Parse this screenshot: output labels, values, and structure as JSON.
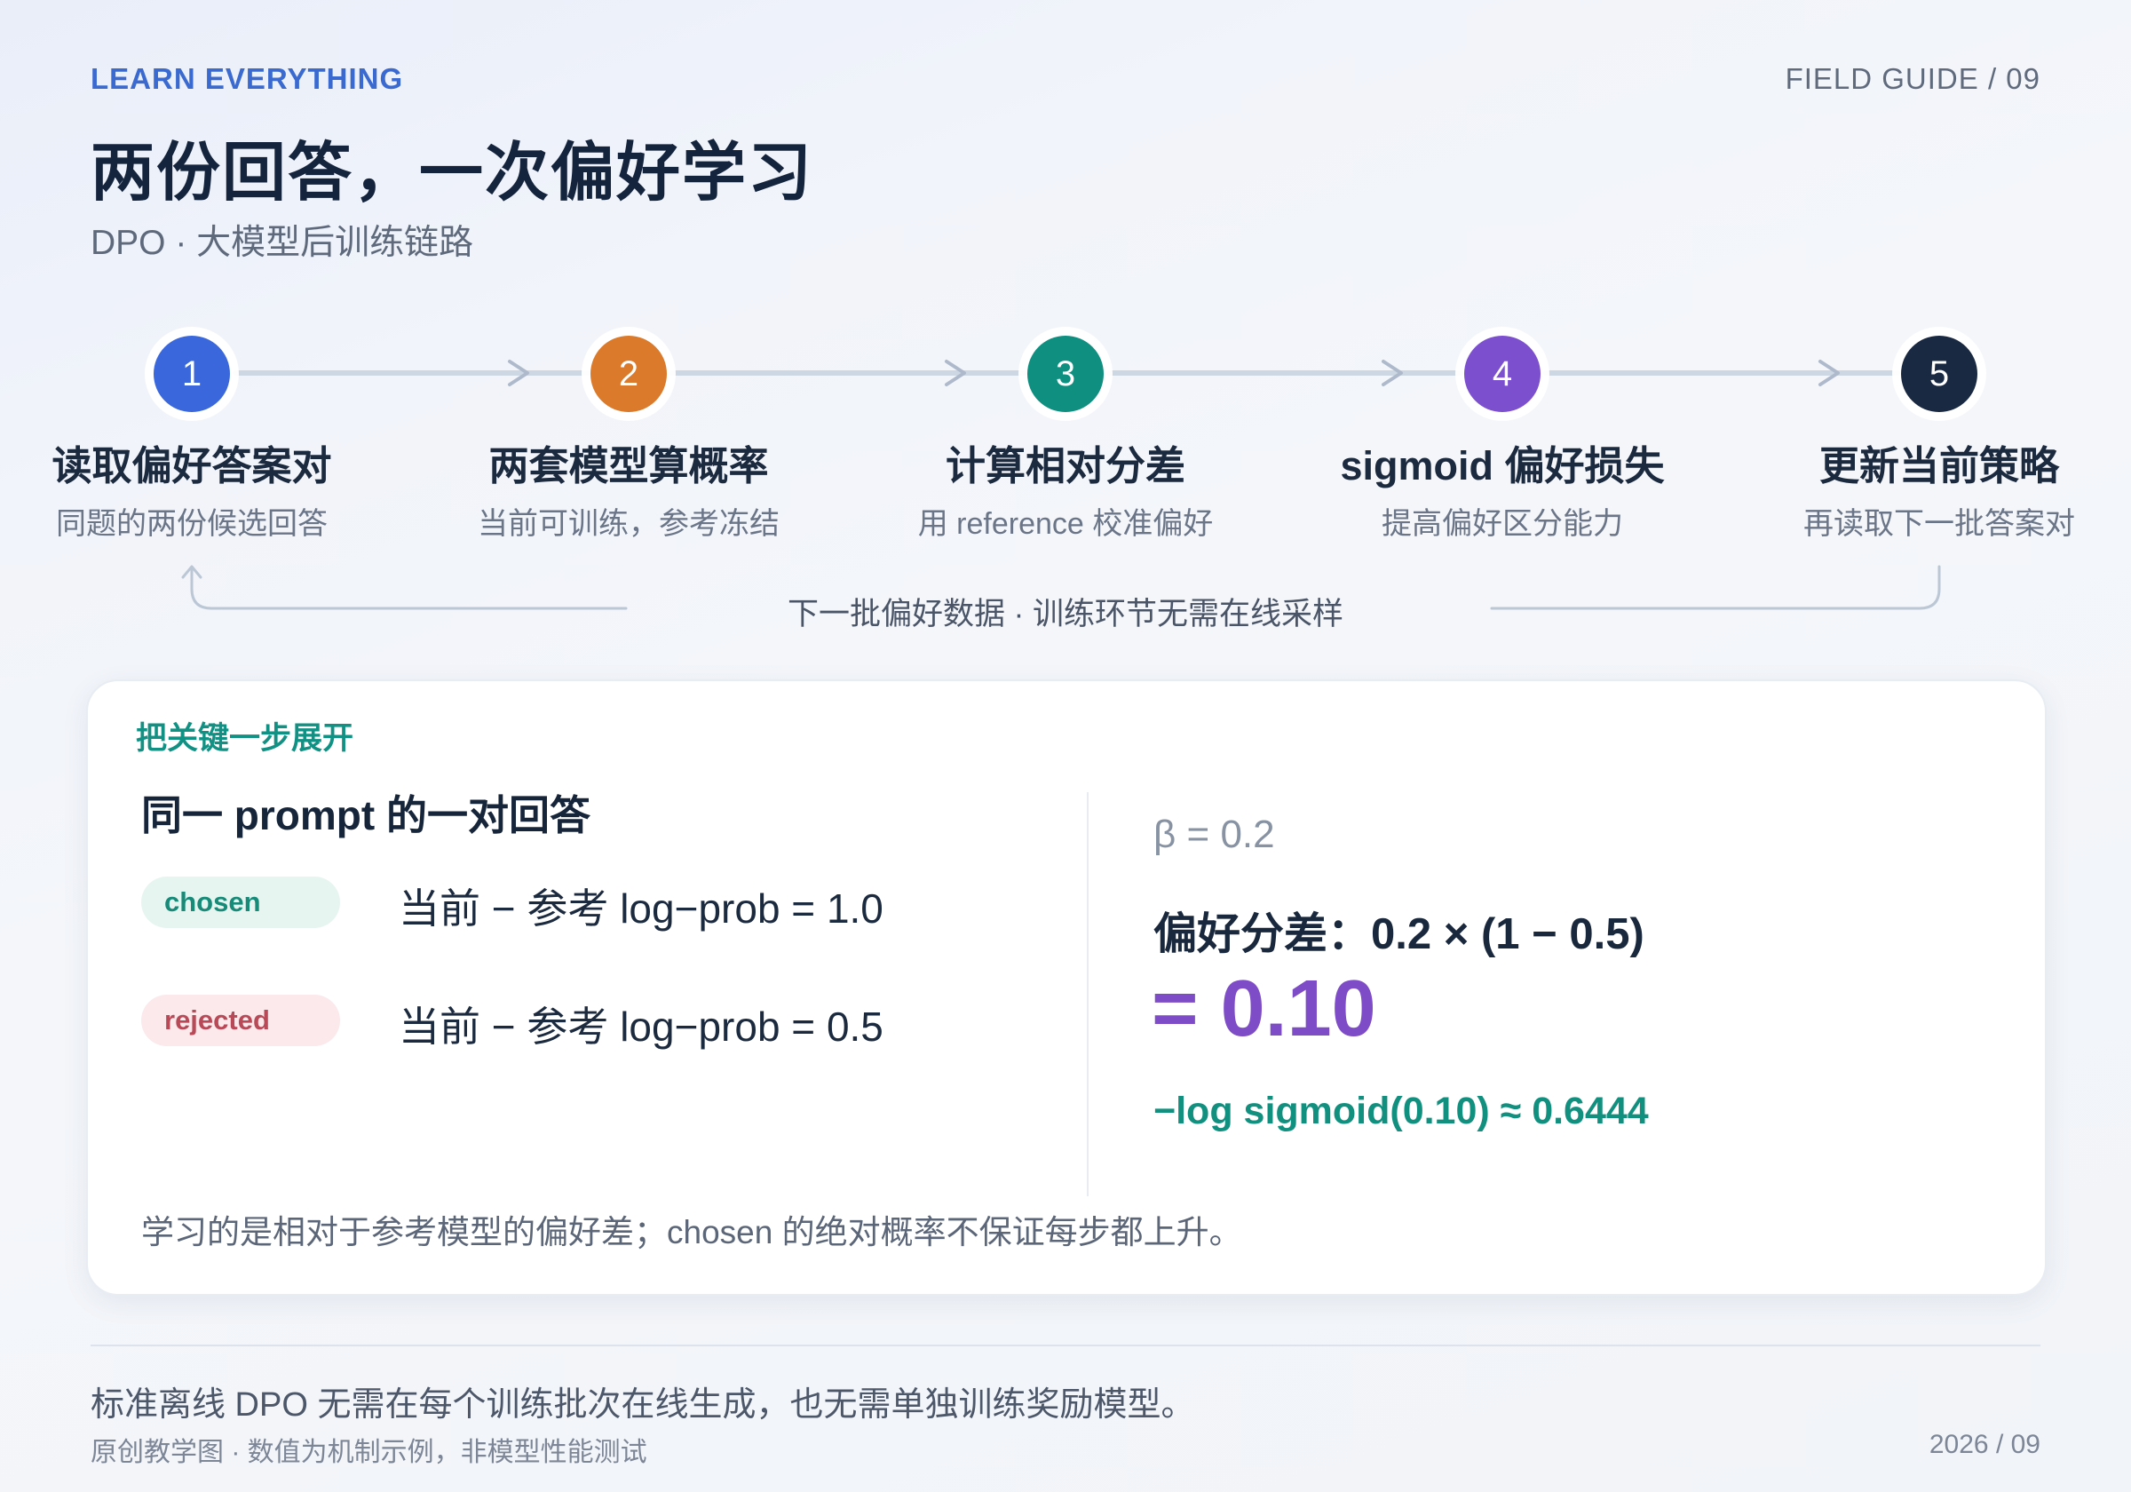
{
  "header": {
    "eyebrow": "LEARN EVERYTHING",
    "guide": "FIELD GUIDE / 09",
    "title": "两份回答，一次偏好学习",
    "subtitle": "DPO · 大模型后训练链路"
  },
  "steps": [
    {
      "num": "1",
      "title": "读取偏好答案对",
      "sub": "同题的两份候选回答",
      "color": "#3a68dc"
    },
    {
      "num": "2",
      "title": "两套模型算概率",
      "sub": "当前可训练，参考冻结",
      "color": "#dc7a2b"
    },
    {
      "num": "3",
      "title": "计算相对分差",
      "sub": "用 reference 校准偏好",
      "color": "#0f8f80"
    },
    {
      "num": "4",
      "title": "sigmoid 偏好损失",
      "sub": "提高偏好区分能力",
      "color": "#7c4fcf"
    },
    {
      "num": "5",
      "title": "更新当前策略",
      "sub": "再读取下一批答案对",
      "color": "#1a2942"
    }
  ],
  "loop_caption": "下一批偏好数据 · 训练环节无需在线采样",
  "card": {
    "eyebrow": "把关键一步展开",
    "heading": "同一 prompt 的一对回答",
    "chosen_label": "chosen",
    "chosen_eq": "当前 − 参考 log−prob = 1.0",
    "rejected_label": "rejected",
    "rejected_eq": "当前 − 参考 log−prob = 0.5",
    "beta": "β = 0.2",
    "diff": "偏好分差：0.2 × (1 − 0.5)",
    "result": "= 0.10",
    "loss": "−log sigmoid(0.10) ≈ 0.6444",
    "note": "学习的是相对于参考模型的偏好差；chosen 的绝对概率不保证每步都上升。"
  },
  "footer": {
    "line1": "标准离线 DPO 无需在每个训练批次在线生成，也无需单独训练奖励模型。",
    "line2": "原创教学图 · 数值为机制示例，非模型性能测试",
    "date": "2026 / 09"
  }
}
